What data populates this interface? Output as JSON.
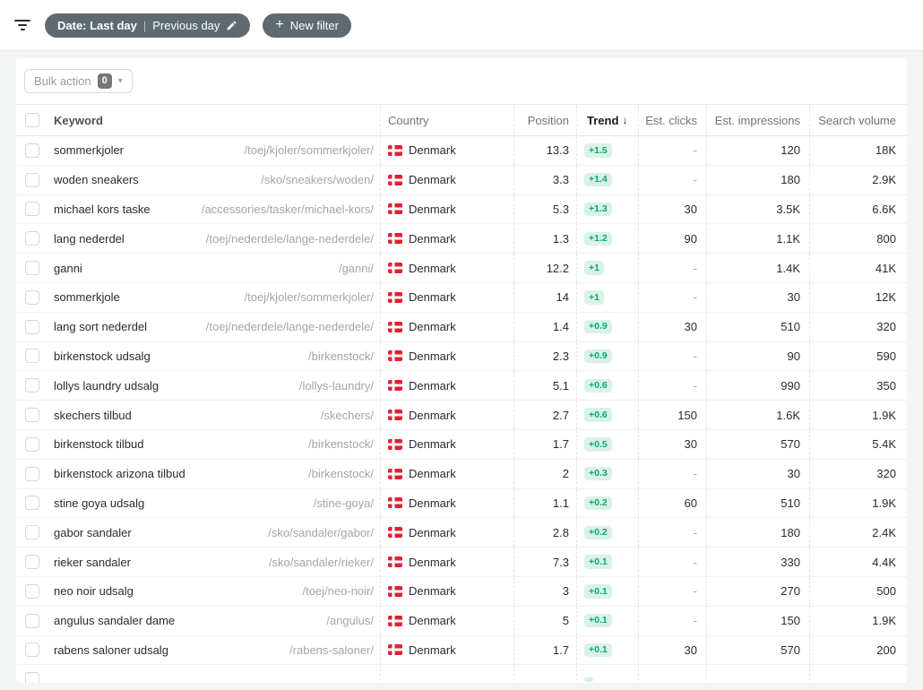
{
  "topbar": {
    "filter_pill": {
      "label_bold": "Date: Last day",
      "divider": "|",
      "label_regular": "Previous day"
    },
    "new_filter": {
      "plus": "+",
      "label": "New filter"
    }
  },
  "bulk": {
    "label": "Bulk action",
    "count": "0"
  },
  "icons": {
    "caret_down": "▾",
    "sort_desc": "↓"
  },
  "colors": {
    "pill_bg": "#5e6a70",
    "trend_badge_bg": "#d9f2e5",
    "trend_badge_text": "#0ca678",
    "flag_red": "#e02030"
  },
  "table": {
    "columns": {
      "keyword": "Keyword",
      "country": "Country",
      "position": "Position",
      "trend": "Trend",
      "est_clicks": "Est. clicks",
      "est_impressions": "Est. impressions",
      "search_volume": "Search volume"
    },
    "rows": [
      {
        "keyword": "sommerkjoler",
        "url": "/toej/kjoler/sommerkjoler/",
        "country": "Denmark",
        "position": "13.3",
        "trend": "+1.5",
        "est_clicks": "-",
        "est_impressions": "120",
        "search_volume": "18K"
      },
      {
        "keyword": "woden sneakers",
        "url": "/sko/sneakers/woden/",
        "country": "Denmark",
        "position": "3.3",
        "trend": "+1.4",
        "est_clicks": "-",
        "est_impressions": "180",
        "search_volume": "2.9K"
      },
      {
        "keyword": "michael kors taske",
        "url": "/accessories/tasker/michael-kors/",
        "country": "Denmark",
        "position": "5.3",
        "trend": "+1.3",
        "est_clicks": "30",
        "est_impressions": "3.5K",
        "search_volume": "6.6K"
      },
      {
        "keyword": "lang nederdel",
        "url": "/toej/nederdele/lange-nederdele/",
        "country": "Denmark",
        "position": "1.3",
        "trend": "+1.2",
        "est_clicks": "90",
        "est_impressions": "1.1K",
        "search_volume": "800"
      },
      {
        "keyword": "ganni",
        "url": "/ganni/",
        "country": "Denmark",
        "position": "12.2",
        "trend": "+1",
        "est_clicks": "-",
        "est_impressions": "1.4K",
        "search_volume": "41K"
      },
      {
        "keyword": "sommerkjole",
        "url": "/toej/kjoler/sommerkjoler/",
        "country": "Denmark",
        "position": "14",
        "trend": "+1",
        "est_clicks": "-",
        "est_impressions": "30",
        "search_volume": "12K"
      },
      {
        "keyword": "lang sort nederdel",
        "url": "/toej/nederdele/lange-nederdele/",
        "country": "Denmark",
        "position": "1.4",
        "trend": "+0.9",
        "est_clicks": "30",
        "est_impressions": "510",
        "search_volume": "320"
      },
      {
        "keyword": "birkenstock udsalg",
        "url": "/birkenstock/",
        "country": "Denmark",
        "position": "2.3",
        "trend": "+0.9",
        "est_clicks": "-",
        "est_impressions": "90",
        "search_volume": "590"
      },
      {
        "keyword": "lollys laundry udsalg",
        "url": "/lollys-laundry/",
        "country": "Denmark",
        "position": "5.1",
        "trend": "+0.6",
        "est_clicks": "-",
        "est_impressions": "990",
        "search_volume": "350"
      },
      {
        "keyword": "skechers tilbud",
        "url": "/skechers/",
        "country": "Denmark",
        "position": "2.7",
        "trend": "+0.6",
        "est_clicks": "150",
        "est_impressions": "1.6K",
        "search_volume": "1.9K"
      },
      {
        "keyword": "birkenstock tilbud",
        "url": "/birkenstock/",
        "country": "Denmark",
        "position": "1.7",
        "trend": "+0.5",
        "est_clicks": "30",
        "est_impressions": "570",
        "search_volume": "5.4K"
      },
      {
        "keyword": "birkenstock arizona tilbud",
        "url": "/birkenstock/",
        "country": "Denmark",
        "position": "2",
        "trend": "+0.3",
        "est_clicks": "-",
        "est_impressions": "30",
        "search_volume": "320"
      },
      {
        "keyword": "stine goya udsalg",
        "url": "/stine-goya/",
        "country": "Denmark",
        "position": "1.1",
        "trend": "+0.2",
        "est_clicks": "60",
        "est_impressions": "510",
        "search_volume": "1.9K"
      },
      {
        "keyword": "gabor sandaler",
        "url": "/sko/sandaler/gabor/",
        "country": "Denmark",
        "position": "2.8",
        "trend": "+0.2",
        "est_clicks": "-",
        "est_impressions": "180",
        "search_volume": "2.4K"
      },
      {
        "keyword": "rieker sandaler",
        "url": "/sko/sandaler/rieker/",
        "country": "Denmark",
        "position": "7.3",
        "trend": "+0.1",
        "est_clicks": "-",
        "est_impressions": "330",
        "search_volume": "4.4K"
      },
      {
        "keyword": "neo noir udsalg",
        "url": "/toej/neo-noir/",
        "country": "Denmark",
        "position": "3",
        "trend": "+0.1",
        "est_clicks": "-",
        "est_impressions": "270",
        "search_volume": "500"
      },
      {
        "keyword": "angulus sandaler dame",
        "url": "/angulus/",
        "country": "Denmark",
        "position": "5",
        "trend": "+0.1",
        "est_clicks": "-",
        "est_impressions": "150",
        "search_volume": "1.9K"
      },
      {
        "keyword": "rabens saloner udsalg",
        "url": "/rabens-saloner/",
        "country": "Denmark",
        "position": "1.7",
        "trend": "+0.1",
        "est_clicks": "30",
        "est_impressions": "570",
        "search_volume": "200"
      }
    ]
  }
}
